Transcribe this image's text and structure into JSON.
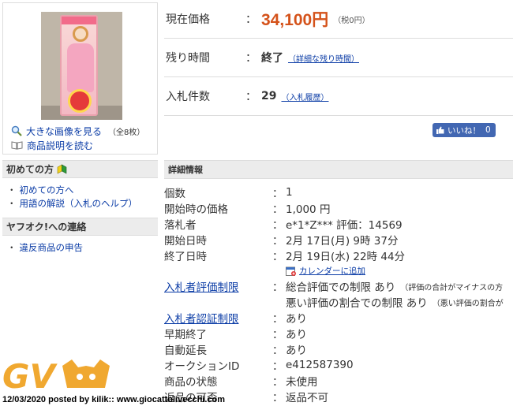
{
  "left": {
    "enlarge_link": "大きな画像を見る",
    "image_count": "（全8枚）",
    "desc_link": "商品説明を読む",
    "beginner_head": "初めての方",
    "beginner_items": [
      "初めての方へ",
      "用語の解説（入札のヘルプ）"
    ],
    "contact_head": "ヤフオク!への連絡",
    "contact_items": [
      "違反商品の申告"
    ]
  },
  "summary": {
    "price_label": "現在価格",
    "price_value": "34,100円",
    "tax_note": "（税0円）",
    "time_label": "残り時間",
    "time_value": "終了",
    "time_link": "（詳細な残り時間）",
    "bids_label": "入札件数",
    "bids_value": "29",
    "bids_link": "（入札履歴）",
    "colon": "："
  },
  "like": {
    "label": "いいね！",
    "count": "0"
  },
  "details": {
    "heading": "詳細情報",
    "quantity_label": "個数",
    "quantity_value": "1",
    "start_price_label": "開始時の価格",
    "start_price_value": "1,000 円",
    "winner_label": "落札者",
    "winner_value": "e*1*Z*** 評価：14569",
    "start_date_label": "開始日時",
    "start_date_value": "2月 17日(月) 9時 37分",
    "end_date_label": "終了日時",
    "end_date_value": "2月 19日(水) 22時 44分",
    "calendar_link": "カレンダーに追加",
    "eval_limit_label": "入札者評価制限",
    "eval_limit_value": "総合評価での制限 あり",
    "eval_limit_note": "（評価の合計がマイナスの方",
    "eval_limit_value2": "悪い評価の割合での制限 あり",
    "eval_limit_note2": "（悪い評価の割合が",
    "auth_limit_label": "入札者認証制限",
    "auth_limit_value": "あり",
    "early_end_label": "早期終了",
    "early_end_value": "あり",
    "auto_ext_label": "自動延長",
    "auto_ext_value": "あり",
    "auction_id_label": "オークションID",
    "auction_id_value": "e412587390",
    "condition_label": "商品の状態",
    "condition_value": "未使用",
    "returns_label": "返品の可否",
    "returns_value": "返品不可",
    "colon": "："
  },
  "watermark": {
    "logo_text": "GV",
    "caption": "12/03/2020 posted by kilik:: www.giocattolivecchi.com",
    "logo_color": "#f0a830"
  },
  "colors": {
    "link": "#0b3ca6",
    "price": "#d4521a",
    "facebook": "#4267b2",
    "section_bg": "#ececec"
  }
}
